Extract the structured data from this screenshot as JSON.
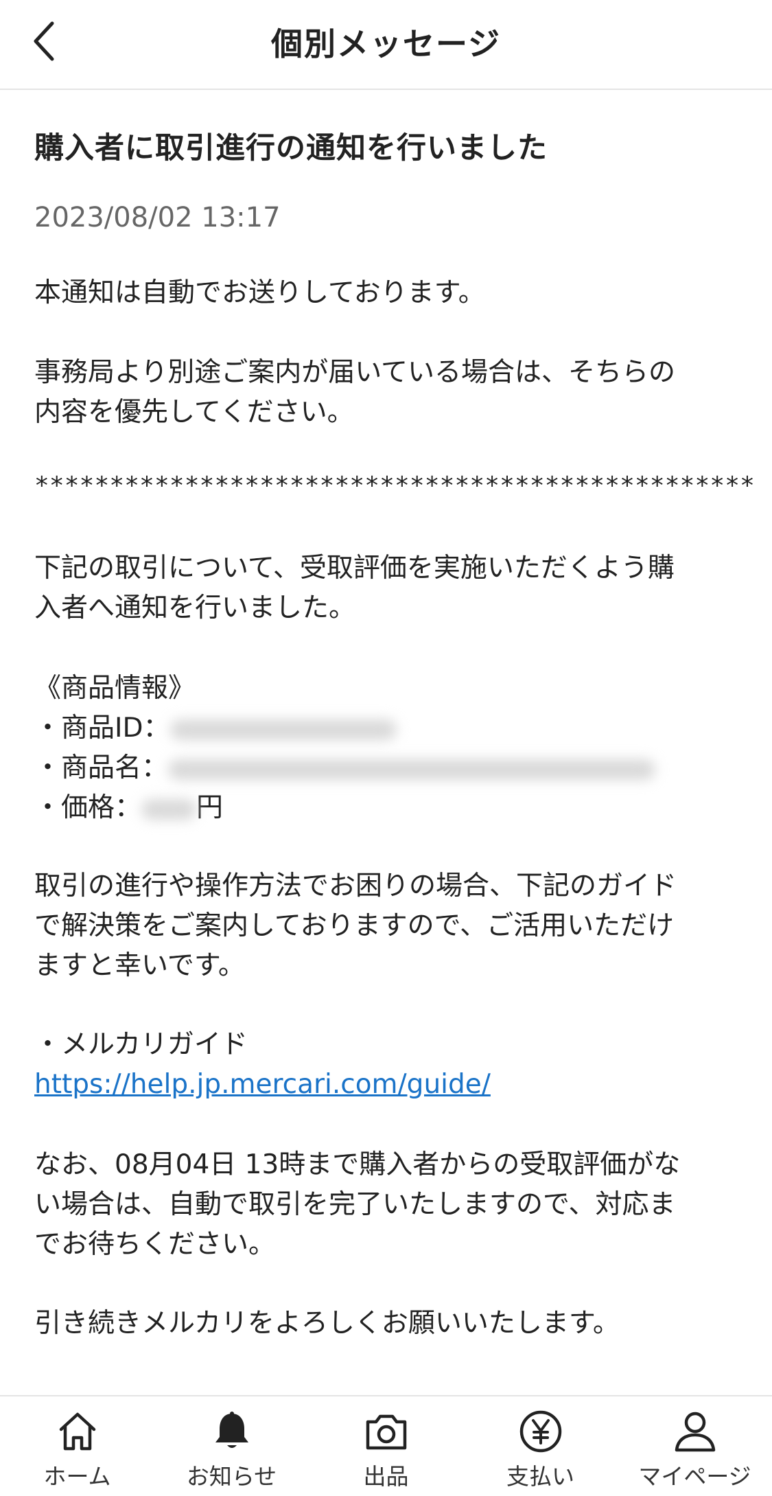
{
  "header": {
    "title": "個別メッセージ",
    "back_icon": "chevron-left-icon"
  },
  "message": {
    "title": "購入者に取引進行の通知を行いました",
    "date": "2023/08/02 13:17",
    "paragraphs": {
      "p1": "本通知は自動でお送りしております。",
      "p2_line1": "事務局より別途ご案内が届いている場合は、そちらの",
      "p2_line2": "内容を優先してください。",
      "separator": "************************************************",
      "p3_line1": "下記の取引について、受取評価を実施いただくよう購",
      "p3_line2": "入者へ通知を行いました。",
      "product_header": "《商品情報》",
      "product_id_label": "・商品ID：",
      "product_name_label": "・商品名：",
      "price_label": "・価格：",
      "price_unit": "円",
      "p4_line1": "取引の進行や操作方法でお困りの場合、下記のガイド",
      "p4_line2": "で解決策をご案内しておりますので、ご活用いただけ",
      "p4_line3": "ますと幸いです。",
      "guide_label": "・メルカリガイド",
      "guide_url": "https://help.jp.mercari.com/guide/",
      "p5_line1": "なお、08月04日 13時まで購入者からの受取評価がな",
      "p5_line2": "い場合は、自動で取引を完了いたしますので、対応ま",
      "p5_line3": "でお待ちください。",
      "p6": "引き続きメルカリをよろしくお願いいたします。"
    }
  },
  "tabbar": {
    "items": [
      {
        "label": "ホーム",
        "icon": "home-icon"
      },
      {
        "label": "お知らせ",
        "icon": "bell-icon"
      },
      {
        "label": "出品",
        "icon": "camera-icon"
      },
      {
        "label": "支払い",
        "icon": "yen-icon"
      },
      {
        "label": "マイページ",
        "icon": "person-icon"
      }
    ]
  },
  "colors": {
    "link": "#1a73c8",
    "date_text": "#666666",
    "divider": "#e4e4e4"
  }
}
